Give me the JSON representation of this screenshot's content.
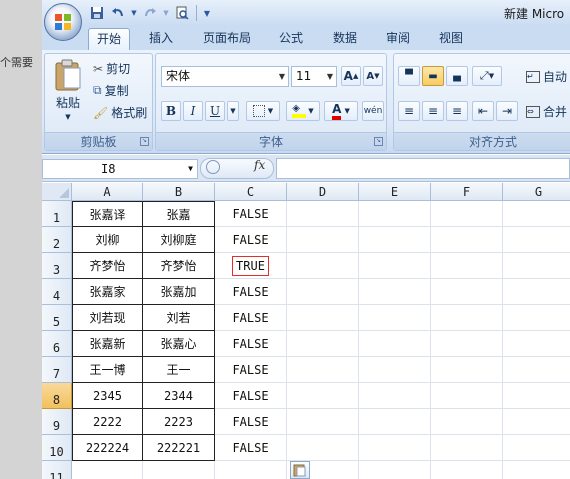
{
  "background": {
    "text": "个需要"
  },
  "title": {
    "text": "新建 Micro"
  },
  "qat": {
    "icons": [
      "save-icon",
      "undo-icon",
      "redo-icon",
      "print-preview-icon",
      "customize-icon"
    ]
  },
  "tabs": [
    {
      "label": "开始",
      "active": true
    },
    {
      "label": "插入",
      "active": false
    },
    {
      "label": "页面布局",
      "active": false
    },
    {
      "label": "公式",
      "active": false
    },
    {
      "label": "数据",
      "active": false
    },
    {
      "label": "审阅",
      "active": false
    },
    {
      "label": "视图",
      "active": false
    }
  ],
  "clipboard": {
    "label": "剪贴板",
    "paste": "粘贴",
    "cut": "剪切",
    "copy": "复制",
    "format_painter": "格式刷"
  },
  "font": {
    "label": "字体",
    "name": "宋体",
    "size": "11",
    "grow": "A",
    "shrink": "A",
    "bold": "B",
    "italic": "I",
    "underline": "U",
    "font_color_letter": "A",
    "phonetic": "wén"
  },
  "alignment": {
    "label": "对齐方式",
    "wrap": "自动",
    "merge": "合并"
  },
  "formula_bar": {
    "name_box": "I8",
    "fx": "fx",
    "value": ""
  },
  "sheet": {
    "columns": [
      "A",
      "B",
      "C",
      "D",
      "E",
      "F",
      "G"
    ],
    "rows": [
      {
        "num": "1",
        "a": "张嘉译",
        "b": "张嘉",
        "c": "FALSE"
      },
      {
        "num": "2",
        "a": "刘柳",
        "b": "刘柳庭",
        "c": "FALSE"
      },
      {
        "num": "3",
        "a": "齐梦怡",
        "b": "齐梦怡",
        "c": "TRUE"
      },
      {
        "num": "4",
        "a": "张嘉家",
        "b": "张嘉加",
        "c": "FALSE"
      },
      {
        "num": "5",
        "a": "刘若现",
        "b": "刘若",
        "c": "FALSE"
      },
      {
        "num": "6",
        "a": "张嘉新",
        "b": "张嘉心",
        "c": "FALSE"
      },
      {
        "num": "7",
        "a": "王一博",
        "b": "王一",
        "c": "FALSE"
      },
      {
        "num": "8",
        "a": "2345",
        "b": "2344",
        "c": "FALSE"
      },
      {
        "num": "9",
        "a": "2222",
        "b": "2223",
        "c": "FALSE"
      },
      {
        "num": "10",
        "a": "222224",
        "b": "222221",
        "c": "FALSE"
      },
      {
        "num": "11",
        "a": "",
        "b": "",
        "c": ""
      }
    ],
    "selected_row": "8",
    "colors": {
      "header_blue": "#dfe8f4",
      "selected_row": "#f1c15f",
      "true_border": "#e0302d"
    }
  }
}
